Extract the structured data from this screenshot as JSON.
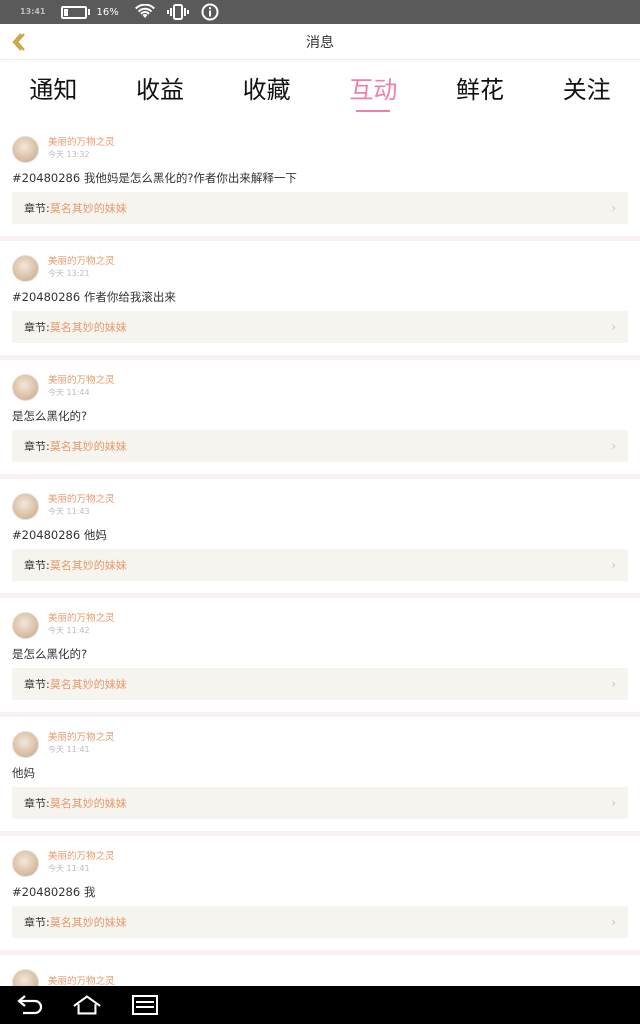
{
  "status_bar": {
    "time": "13:41",
    "battery_pct": "16%"
  },
  "header": {
    "title": "消息"
  },
  "tabs": [
    {
      "label": "通知"
    },
    {
      "label": "收益"
    },
    {
      "label": "收藏"
    },
    {
      "label": "互动",
      "active": true
    },
    {
      "label": "鲜花"
    },
    {
      "label": "关注"
    }
  ],
  "chapter_prefix": "章节:",
  "messages": [
    {
      "user": "美丽的万物之灵",
      "time": "今天 13:32",
      "content": "#20480286 我他妈是怎么黑化的?作者你出来解释一下",
      "chapter": "莫名其妙的妹妹"
    },
    {
      "user": "美丽的万物之灵",
      "time": "今天 13:21",
      "content": "#20480286 作者你给我滚出来",
      "chapter": "莫名其妙的妹妹"
    },
    {
      "user": "美丽的万物之灵",
      "time": "今天 11:44",
      "content": "是怎么黑化的?",
      "chapter": "莫名其妙的妹妹"
    },
    {
      "user": "美丽的万物之灵",
      "time": "今天 11:43",
      "content": "#20480286 他妈",
      "chapter": "莫名其妙的妹妹"
    },
    {
      "user": "美丽的万物之灵",
      "time": "今天 11:42",
      "content": "是怎么黑化的?",
      "chapter": "莫名其妙的妹妹"
    },
    {
      "user": "美丽的万物之灵",
      "time": "今天 11:41",
      "content": "他妈",
      "chapter": "莫名其妙的妹妹"
    },
    {
      "user": "美丽的万物之灵",
      "time": "今天 11:41",
      "content": "#20480286 我",
      "chapter": "莫名其妙的妹妹"
    },
    {
      "user": "美丽的万物之灵",
      "time": "",
      "content": "",
      "chapter": ""
    }
  ]
}
